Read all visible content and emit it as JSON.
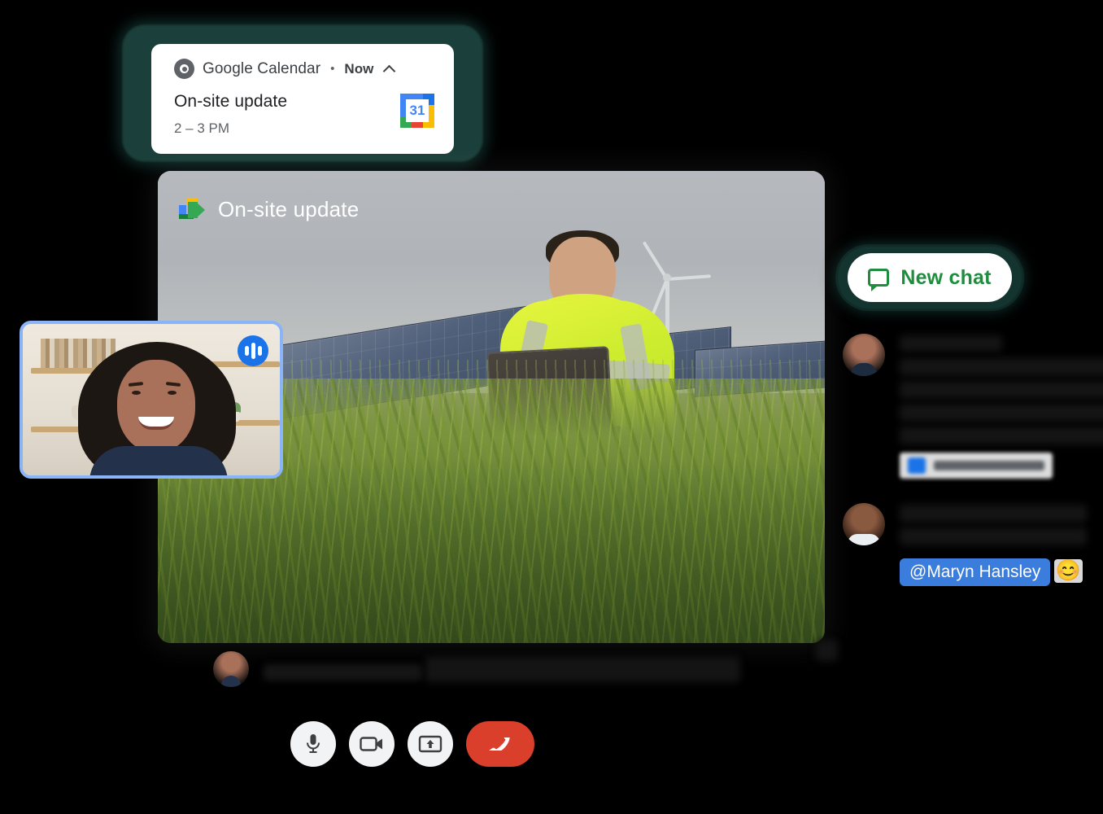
{
  "notification": {
    "app_name": "Google Calendar",
    "separator": "•",
    "time_label": "Now",
    "collapse_icon": "chevron-up-icon",
    "source_icon": "chrome-icon",
    "title": "On-site update",
    "subtitle": "2 – 3 PM",
    "app_icon": "google-calendar-icon",
    "app_icon_day": "31",
    "glow_color": "#1b3f3a"
  },
  "meeting": {
    "app_icon": "google-meet-icon",
    "title": "On-site update",
    "self_tile": {
      "speaking_indicator": "audio-wave-icon",
      "border_color": "#8ab4f8"
    },
    "caption": {
      "speaker_name_redacted": "Redacted speaker name",
      "text_redacted": "Redacted live caption text line"
    },
    "controls": [
      {
        "name": "microphone-button",
        "icon": "microphone-icon",
        "style": "light"
      },
      {
        "name": "camera-button",
        "icon": "video-camera-icon",
        "style": "light"
      },
      {
        "name": "present-screen-button",
        "icon": "present-screen-icon",
        "style": "light"
      },
      {
        "name": "end-call-button",
        "icon": "phone-hangup-icon",
        "style": "danger",
        "color": "#d93f2b"
      }
    ]
  },
  "chat": {
    "new_chat_label": "New chat",
    "new_chat_icon": "chat-bubble-icon",
    "new_chat_text_color": "#1e8e3e",
    "new_chat_glow_color": "#14342f",
    "messages": [
      {
        "avatar": "avatar-participant-1",
        "name_redacted": "Redacted name",
        "lines_redacted": [
          "Redacted chat message line one",
          "Redacted second line here",
          "Redacted third message line",
          "Redacted text."
        ],
        "attachment": {
          "icon": "file-attachment-icon",
          "label_redacted": "Redacted attachment"
        }
      },
      {
        "avatar": "avatar-participant-2",
        "name_redacted": "Redacted name",
        "lines_redacted": [
          "Redacted message",
          "Redacted"
        ],
        "mention": "@Maryn Hansley",
        "mention_color": "#3b7ddd",
        "reaction": "😊"
      }
    ]
  }
}
